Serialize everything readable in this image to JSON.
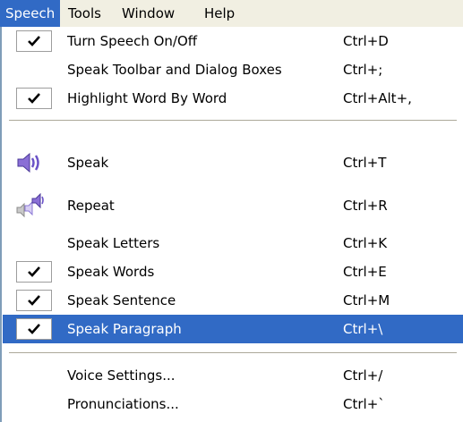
{
  "menubar": {
    "items": [
      {
        "label": "Speech",
        "active": true
      },
      {
        "label": "Tools"
      },
      {
        "label": "Window"
      },
      {
        "label": "Help"
      }
    ]
  },
  "menu": {
    "items": [
      {
        "label": "Turn Speech On/Off",
        "shortcut": "Ctrl+D",
        "checked": true
      },
      {
        "label": "Speak Toolbar and Dialog Boxes",
        "shortcut": "Ctrl+;",
        "checked": false
      },
      {
        "label": "Highlight Word By Word",
        "shortcut": "Ctrl+Alt+,",
        "checked": true
      },
      {
        "label": "Speak",
        "shortcut": "Ctrl+T",
        "icon": "speaker-icon"
      },
      {
        "label": "Repeat",
        "shortcut": "Ctrl+R",
        "icon": "repeat-speaker-icon"
      },
      {
        "label": "Speak Letters",
        "shortcut": "Ctrl+K",
        "checked": false
      },
      {
        "label": "Speak Words",
        "shortcut": "Ctrl+E",
        "checked": true
      },
      {
        "label": "Speak Sentence",
        "shortcut": "Ctrl+M",
        "checked": true
      },
      {
        "label": "Speak Paragraph",
        "shortcut": "Ctrl+\\",
        "checked": true,
        "highlighted": true
      },
      {
        "label": "Voice Settings...",
        "shortcut": "Ctrl+/"
      },
      {
        "label": "Pronunciations...",
        "shortcut": "Ctrl+`"
      }
    ]
  },
  "colors": {
    "highlight": "#316ac5",
    "menubar_bg": "#f1efe2",
    "separator": "#aca899",
    "icon_purple": "#8a6fd6"
  }
}
